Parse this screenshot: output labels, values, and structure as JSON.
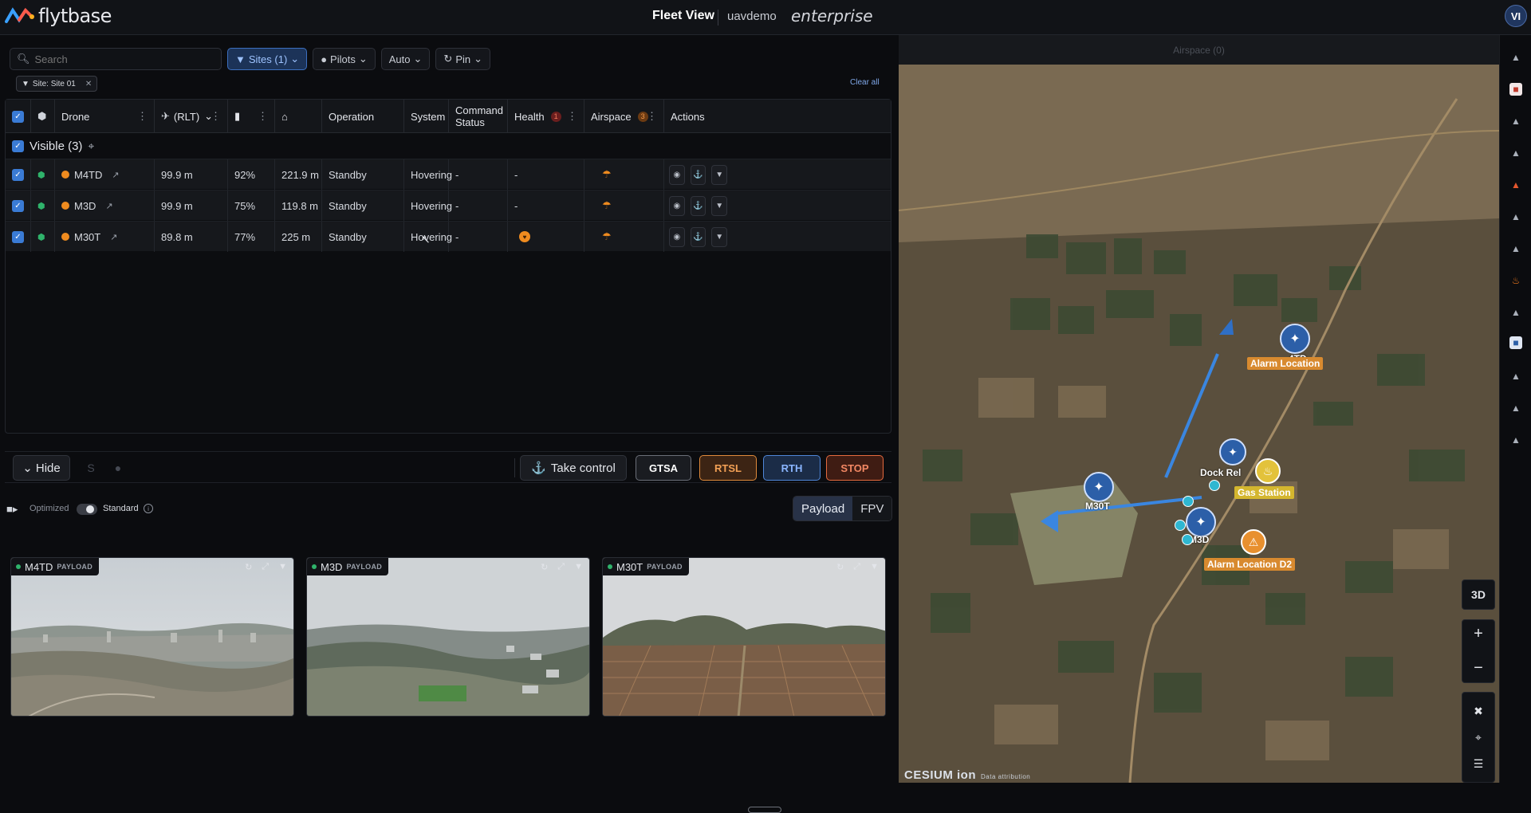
{
  "header": {
    "brand": "flytbase",
    "title": "Fleet View",
    "org": "uavdemo",
    "plan": "enterprise",
    "avatar": "VI"
  },
  "filters": {
    "search_placeholder": "Search",
    "sites": "Sites (1)",
    "pilots": "Pilots",
    "auto": "Auto",
    "pin": "Pin",
    "chip": "Site: Site 01",
    "clear_all": "Clear all"
  },
  "table": {
    "columns": {
      "drone": "Drone",
      "rlt": "(RLT)",
      "operation": "Operation",
      "system_status": "System St",
      "command_status": "Command Status",
      "health": "Health",
      "health_count": "1",
      "airspace": "Airspace",
      "airspace_count": "3",
      "actions": "Actions"
    },
    "group_label": "Visible (3)",
    "rows": [
      {
        "name": "M4TD",
        "rlt": "99.9 m",
        "battery": "92%",
        "home": "221.9 m",
        "operation": "Standby",
        "system": "Hovering",
        "command": "-",
        "health": "-"
      },
      {
        "name": "M3D",
        "rlt": "99.9 m",
        "battery": "75%",
        "home": "119.8 m",
        "operation": "Standby",
        "system": "Hovering",
        "command": "-",
        "health": "-"
      },
      {
        "name": "M30T",
        "rlt": "89.8 m",
        "battery": "77%",
        "home": "225 m",
        "operation": "Standby",
        "system": "Hovering",
        "command": "-",
        "health": ""
      }
    ]
  },
  "actions": {
    "hide": "Hide",
    "take_control": "Take control",
    "gtsa": "GTSA",
    "rtsl": "RTSL",
    "rth": "RTH",
    "stop": "STOP"
  },
  "video": {
    "optimized": "Optimized",
    "standard": "Standard",
    "payload": "Payload",
    "fpv": "FPV",
    "payload_tag": "PAYLOAD",
    "tiles": [
      {
        "name": "M4TD"
      },
      {
        "name": "M3D"
      },
      {
        "name": "M30T"
      }
    ]
  },
  "map": {
    "airspace_header": "Airspace (0)",
    "labels": {
      "alarm": "Alarm Location",
      "gas": "Gas Station",
      "alarm_d2": "Alarm Location D2",
      "m30t": "M30T",
      "m3d": "M3D",
      "m4td": "4TD",
      "dock": "Dock Rel"
    },
    "controls": {
      "mode_3d": "3D",
      "zoom_in": "+",
      "zoom_out": "−"
    },
    "attribution": "CESIUM ion",
    "attribution_small": "Data attribution"
  },
  "colors": {
    "accent": "#3a7bd5",
    "warning": "#ef8b1f",
    "stop": "#e56a3e",
    "rth": "#4f86d8"
  }
}
